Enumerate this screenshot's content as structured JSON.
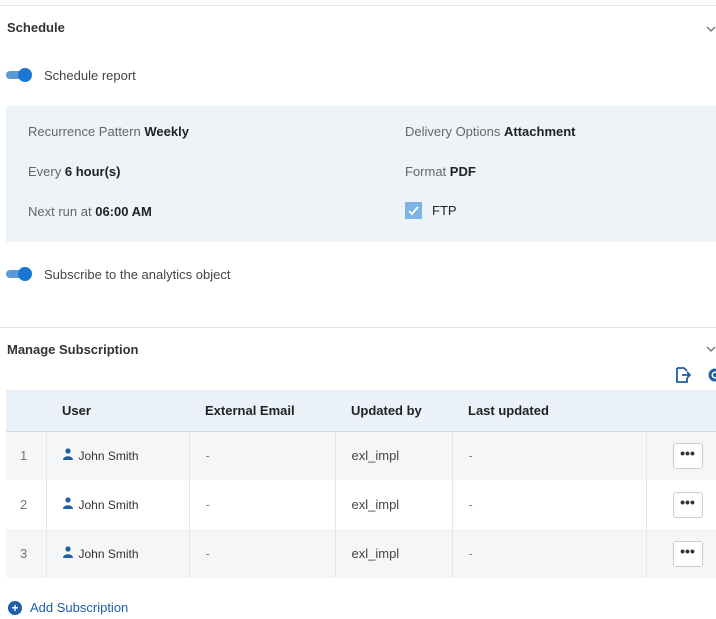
{
  "schedule": {
    "title": "Schedule",
    "toggle_label": "Schedule report",
    "recurrence_label": "Recurrence Pattern",
    "recurrence_value": "Weekly",
    "every_label": "Every",
    "every_value": "6 hour(s)",
    "next_run_label": "Next run at",
    "next_run_value": "06:00 AM",
    "delivery_label": "Delivery Options",
    "delivery_value": "Attachment",
    "format_label": "Format",
    "format_value": "PDF",
    "ftp_label": "FTP",
    "subscribe_label": "Subscribe to the analytics object"
  },
  "subscription": {
    "title": "Manage Subscription",
    "columns": [
      "",
      "User",
      "External Email",
      "Updated by",
      "Last updated",
      ""
    ],
    "rows": [
      {
        "index": "1",
        "user": "John Smith",
        "email": "-",
        "updated_by": "exl_impl",
        "last_updated": "-",
        "more": "•••"
      },
      {
        "index": "2",
        "user": "John Smith",
        "email": "-",
        "updated_by": "exl_impl",
        "last_updated": "-",
        "more": "•••"
      },
      {
        "index": "3",
        "user": "John Smith",
        "email": "-",
        "updated_by": "exl_impl",
        "last_updated": "-",
        "more": "•••"
      }
    ],
    "add_label": "Add Subscription"
  },
  "icons": {
    "collapse": "chevron-down-icon",
    "export": "export-icon",
    "settings": "gear-icon",
    "user": "user-icon",
    "add": "plus-circle-icon",
    "checkbox": "checkbox-checked-icon"
  },
  "colors": {
    "accent": "#1976d2",
    "panel_bg": "#eef3f8",
    "header_bg": "#eaf1f8",
    "link": "#1f5fa8"
  }
}
